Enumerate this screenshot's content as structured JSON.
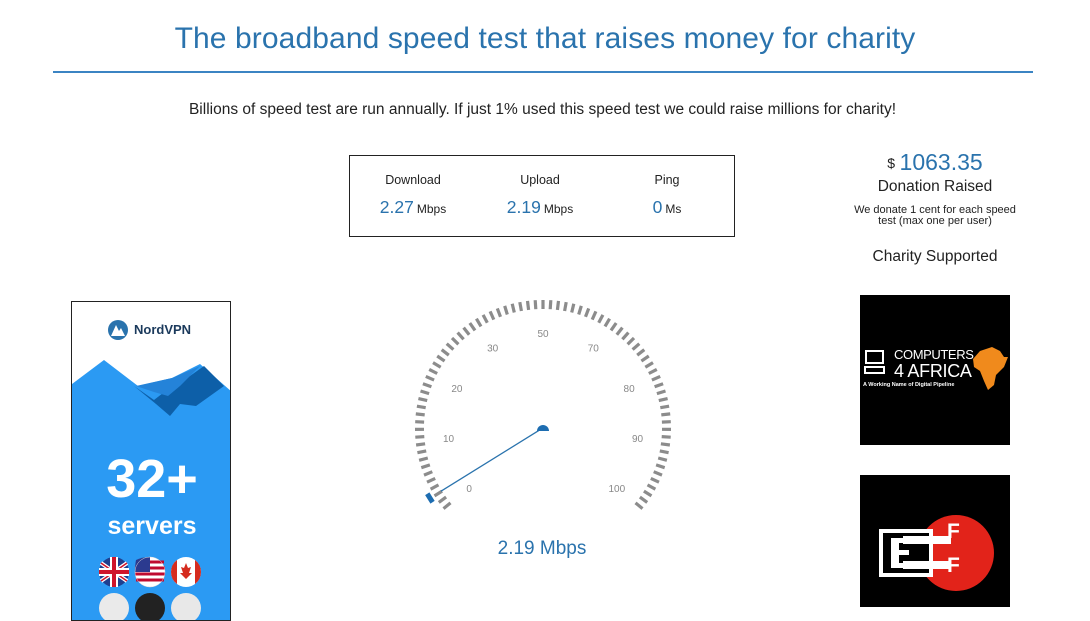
{
  "header": {
    "title": "The broadband speed test that raises money for charity",
    "tagline": "Billions of speed test are run annually. If just 1% used this speed test we could raise millions for charity!"
  },
  "results": [
    {
      "label": "Download",
      "value": "2.27",
      "unit": "Mbps"
    },
    {
      "label": "Upload",
      "value": "2.19",
      "unit": "Mbps"
    },
    {
      "label": "Ping",
      "value": "0",
      "unit": "Ms"
    }
  ],
  "donation": {
    "currency": "$",
    "amount": "1063.35",
    "raised_label": "Donation Raised",
    "note_line1": "We donate 1 cent for each speed",
    "note_line2": "test (max one per user)",
    "charity_label": "Charity Supported"
  },
  "gauge": {
    "tick_labels": [
      "0",
      "10",
      "20",
      "30",
      "50",
      "70",
      "80",
      "90",
      "100"
    ],
    "needle_value_mbps": 2.19,
    "readout": "2.19 Mbps",
    "accent_color": "#2a73ad"
  },
  "ad": {
    "brand": "NordVPN",
    "headline": "32+",
    "subline": "servers",
    "flags": [
      "uk-flag-icon",
      "us-flag-icon",
      "canada-flag-icon"
    ],
    "background_color": "#2b9af3"
  },
  "charities": [
    {
      "name_line1": "COMPUTERS",
      "name_line2": "4 AFRICA",
      "tagline": "A Working Name of Digital Pipeline"
    },
    {
      "name": "EFF"
    }
  ]
}
